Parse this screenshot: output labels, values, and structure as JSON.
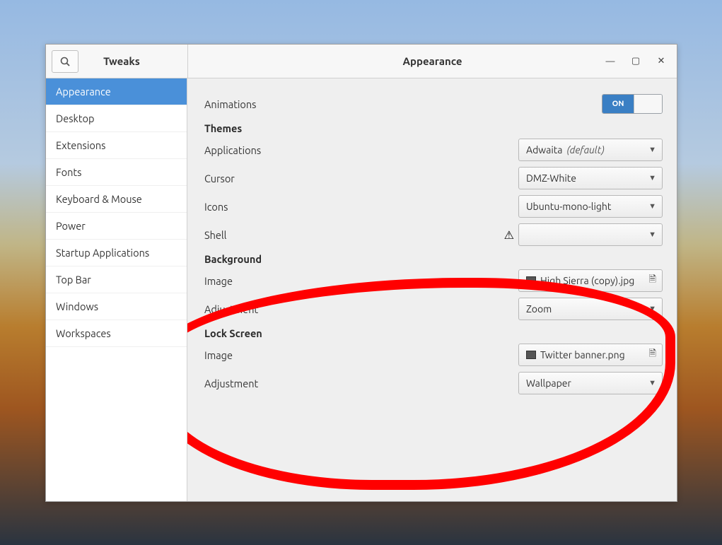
{
  "titlebar": {
    "app_title": "Tweaks",
    "page_title": "Appearance"
  },
  "sidebar": {
    "items": [
      {
        "label": "Appearance",
        "selected": true
      },
      {
        "label": "Desktop"
      },
      {
        "label": "Extensions"
      },
      {
        "label": "Fonts"
      },
      {
        "label": "Keyboard & Mouse"
      },
      {
        "label": "Power"
      },
      {
        "label": "Startup Applications"
      },
      {
        "label": "Top Bar"
      },
      {
        "label": "Windows"
      },
      {
        "label": "Workspaces"
      }
    ]
  },
  "main": {
    "animations": {
      "label": "Animations",
      "toggle_state": "ON"
    },
    "themes": {
      "title": "Themes",
      "applications": {
        "label": "Applications",
        "value": "Adwaita",
        "suffix": "(default)"
      },
      "cursor": {
        "label": "Cursor",
        "value": "DMZ-White"
      },
      "icons": {
        "label": "Icons",
        "value": "Ubuntu-mono-light"
      },
      "shell": {
        "label": "Shell",
        "value": ""
      }
    },
    "background": {
      "title": "Background",
      "image": {
        "label": "Image",
        "value": "High Sierra (copy).jpg"
      },
      "adjustment": {
        "label": "Adjustment",
        "value": "Zoom"
      }
    },
    "lockscreen": {
      "title": "Lock Screen",
      "image": {
        "label": "Image",
        "value": "Twitter banner.png"
      },
      "adjustment": {
        "label": "Adjustment",
        "value": "Wallpaper"
      }
    }
  }
}
